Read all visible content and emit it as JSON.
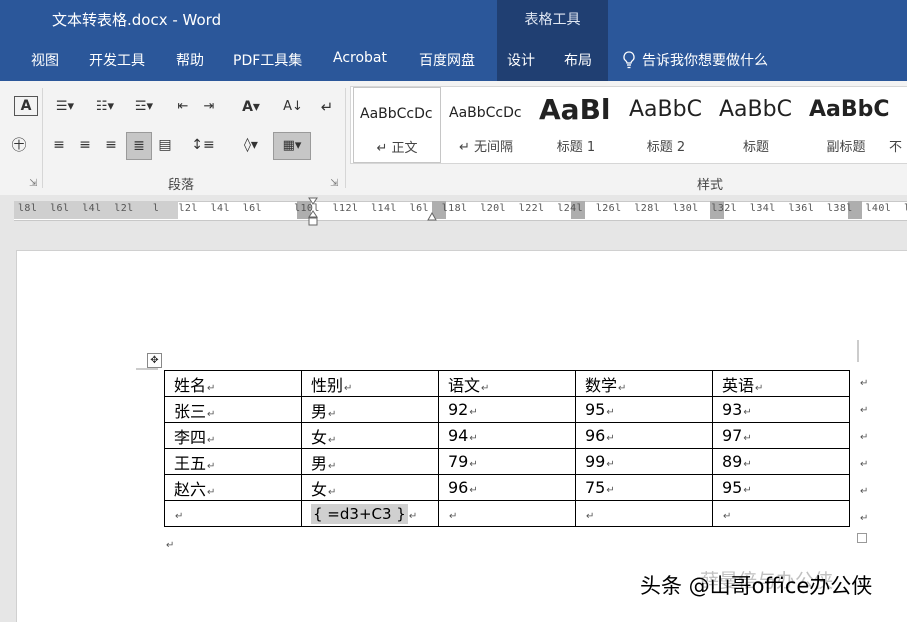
{
  "window": {
    "title": "文本转表格.docx  -  Word",
    "context_tab_group": "表格工具"
  },
  "tabs": [
    "视图",
    "开发工具",
    "帮助",
    "PDF工具集",
    "Acrobat",
    "百度网盘",
    "设计",
    "布局"
  ],
  "tell_me": "告诉我你想要做什么",
  "ribbon": {
    "paragraph_label": "段落",
    "styles_label": "样式",
    "styles": [
      {
        "sample": "AaBbCcDc",
        "name": "↵ 正文"
      },
      {
        "sample": "AaBbCcDc",
        "name": "↵ 无间隔"
      },
      {
        "sample": "AaBl",
        "name": "标题 1"
      },
      {
        "sample": "AaBbC",
        "name": "标题 2"
      },
      {
        "sample": "AaBbC",
        "name": "标题"
      },
      {
        "sample": "AaBbC",
        "name": "副标题"
      },
      {
        "sample": "",
        "name": "不"
      }
    ]
  },
  "ruler": {
    "labels": "l8l  l6l  l4l  l2l   l   l2l  l4l  l6l     l10l  l12l  l14l  l6l  l18l  l20l  l22l  l24l  l26l  l28l  l30l  l32l  l34l  l36l  l38l  l40l  l4"
  },
  "table": {
    "headers": [
      "姓名",
      "性别",
      "语文",
      "数学",
      "英语"
    ],
    "rows": [
      [
        "张三",
        "男",
        "92",
        "95",
        "93"
      ],
      [
        "李四",
        "女",
        "94",
        "96",
        "97"
      ],
      [
        "王五",
        "男",
        "79",
        "99",
        "89"
      ],
      [
        "赵六",
        "女",
        "96",
        "75",
        "95"
      ]
    ],
    "formula_row": [
      "",
      "{ =d3+C3 }",
      "",
      "",
      ""
    ]
  },
  "marks": {
    "cell_end": "↵",
    "move_handle": "✥"
  },
  "watermark": {
    "text": "头条 @山哥office办公侠",
    "ghost": "薛曼倍与办公侠"
  },
  "colors": {
    "title_bar": "#2b579a",
    "context_band": "#203f72",
    "field_shading": "#d0d0d0"
  }
}
